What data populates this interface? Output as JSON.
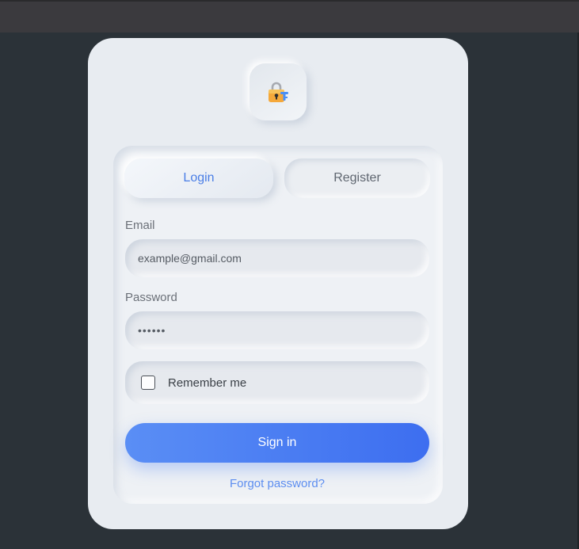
{
  "logo": {
    "icon": "padlock-key-icon"
  },
  "tabs": {
    "login": "Login",
    "register": "Register"
  },
  "email": {
    "label": "Email",
    "value": "example@gmail.com"
  },
  "password": {
    "label": "Password",
    "value": "••••••"
  },
  "remember": {
    "label": "Remember me",
    "checked": false
  },
  "signin": {
    "label": "Sign in"
  },
  "forgot": {
    "label": "Forgot password?"
  },
  "colors": {
    "background": "#2b3238",
    "card": "#e8ecf1",
    "accent": "#4d80f0",
    "active_tab_text": "#4a7ee6"
  }
}
